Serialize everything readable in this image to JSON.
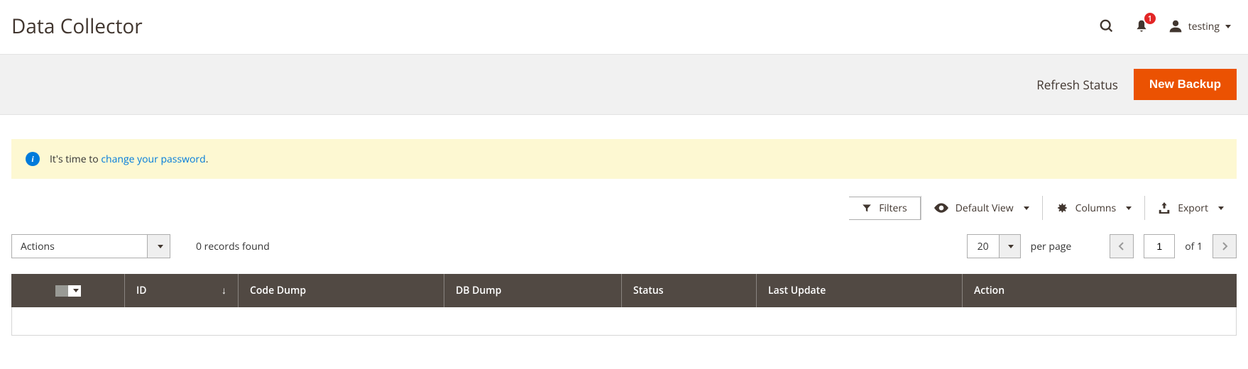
{
  "header": {
    "title": "Data Collector",
    "notification_count": "1",
    "username": "testing"
  },
  "action_bar": {
    "refresh_label": "Refresh Status",
    "new_backup_label": "New Backup"
  },
  "notice": {
    "prefix": "It's time to ",
    "link_text": "change your password",
    "suffix": "."
  },
  "toolbar": {
    "filters_label": "Filters",
    "default_view_label": "Default View",
    "columns_label": "Columns",
    "export_label": "Export"
  },
  "list": {
    "actions_label": "Actions",
    "records_found": "0 records found",
    "per_page_value": "20",
    "per_page_label": "per page",
    "current_page": "1",
    "total_pages_label": "of 1"
  },
  "columns": {
    "id": "ID",
    "code_dump": "Code Dump",
    "db_dump": "DB Dump",
    "status": "Status",
    "last_update": "Last Update",
    "action": "Action"
  }
}
